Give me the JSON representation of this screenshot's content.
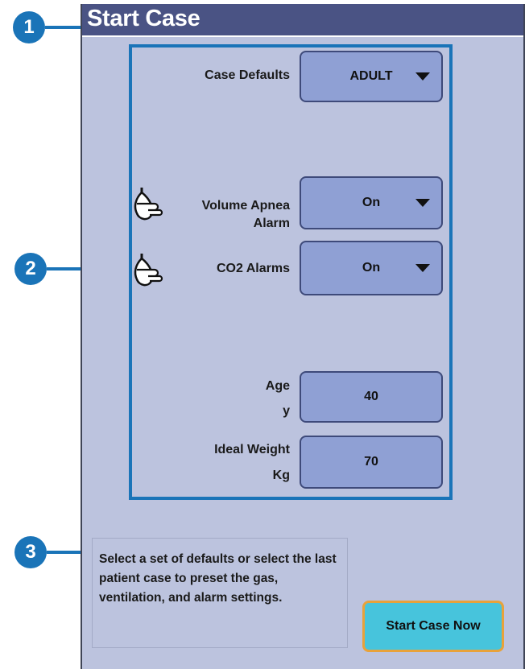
{
  "window": {
    "title": "Start Case"
  },
  "callouts": {
    "one": "1",
    "two": "2",
    "three": "3"
  },
  "case_defaults": {
    "label": "Case Defaults",
    "value": "ADULT"
  },
  "volume_apnea": {
    "label_line1": "Volume Apnea",
    "label_line2": "Alarm",
    "value": "On",
    "icon": "bag-hand-icon"
  },
  "co2_alarms": {
    "label": "CO2 Alarms",
    "value": "On",
    "icon": "bag-hand-icon"
  },
  "age": {
    "label": "Age",
    "unit": "y",
    "value": "40"
  },
  "ideal_weight": {
    "label": "Ideal Weight",
    "unit": "Kg",
    "value": "70"
  },
  "hint": {
    "text": "Select a set of defaults or select the last patient case to preset the gas, ventilation, and alarm settings."
  },
  "start_button": {
    "label": "Start Case Now"
  },
  "colors": {
    "title_bar": "#4a5384",
    "panel": "#bcc3de",
    "control": "#8fa0d4",
    "callout": "#1a74b8",
    "start_button": "#47c4dc",
    "start_border": "#e8a23a"
  }
}
